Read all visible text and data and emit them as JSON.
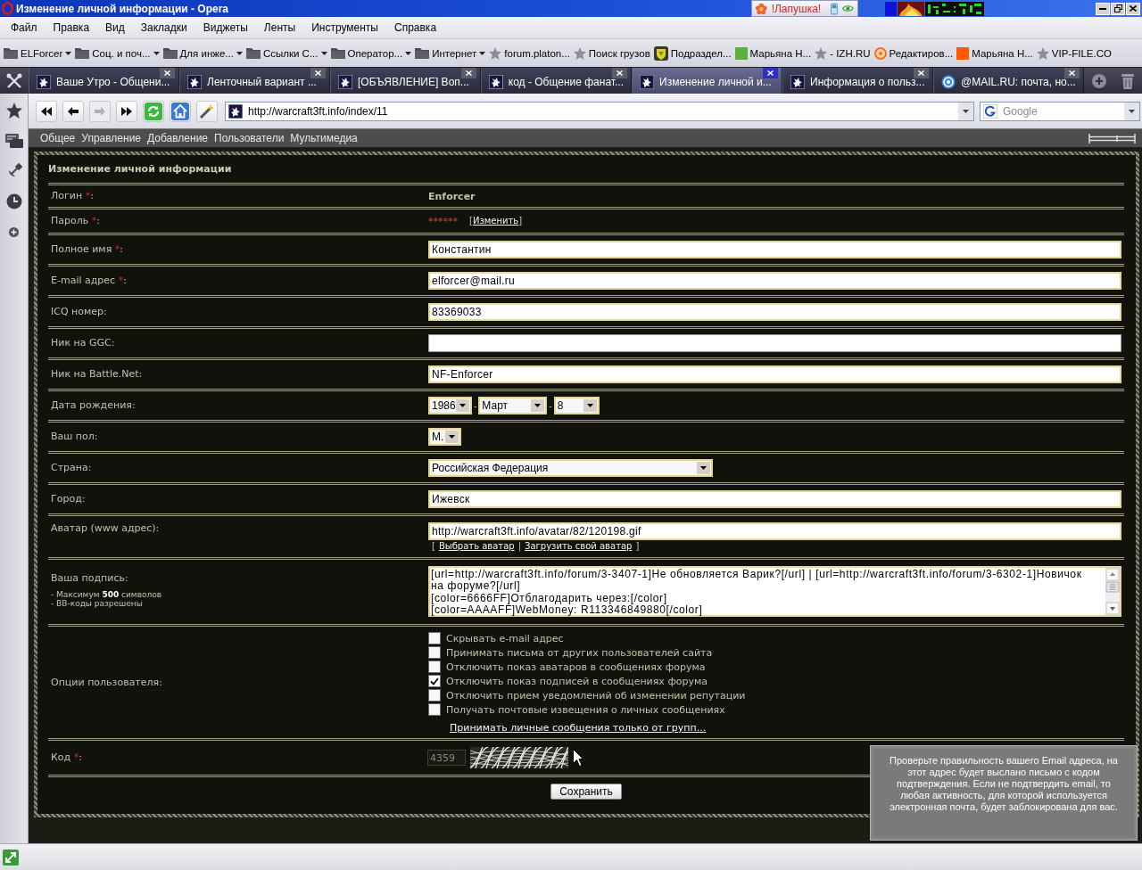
{
  "window": {
    "title": "Изменение личной информации - Opera",
    "widget_label": "!Лапушка!"
  },
  "menu": [
    "Файл",
    "Правка",
    "Вид",
    "Закладки",
    "Виджеты",
    "Ленты",
    "Инструменты",
    "Справка"
  ],
  "bookmarks": [
    {
      "kind": "folder",
      "label": "ELForcer"
    },
    {
      "kind": "folder",
      "label": "Соц. и поч..."
    },
    {
      "kind": "folder",
      "label": "Для инже..."
    },
    {
      "kind": "folder",
      "label": "Ссылки С..."
    },
    {
      "kind": "folder",
      "label": "Оператор..."
    },
    {
      "kind": "folder",
      "label": "Интернет"
    },
    {
      "kind": "star",
      "label": "forum.platon..."
    },
    {
      "kind": "star",
      "label": "Поиск грузов"
    },
    {
      "kind": "badge",
      "label": "Подраздел..."
    },
    {
      "kind": "square",
      "label": "Марьяна Н...",
      "color": "#5cb040"
    },
    {
      "kind": "star",
      "label": "- IZH.RU"
    },
    {
      "kind": "target",
      "label": "Редактиров..."
    },
    {
      "kind": "square",
      "label": "Марьяна Н...",
      "color": "#ff5a00"
    },
    {
      "kind": "star",
      "label": "VIP-FILE.CO"
    }
  ],
  "tabs": [
    {
      "kind": "site",
      "label": "Ваше Утро - Общени...",
      "selected": false
    },
    {
      "kind": "site",
      "label": "Ленточный вариант ...",
      "selected": false
    },
    {
      "kind": "site",
      "label": "[ОБЪЯВЛЕНИЕ] Воп...",
      "selected": false
    },
    {
      "kind": "site",
      "label": "код - Общение фанат...",
      "selected": false
    },
    {
      "kind": "site",
      "label": "Изменение личной и...",
      "selected": true
    },
    {
      "kind": "site",
      "label": "Информация о польз...",
      "selected": false
    },
    {
      "kind": "mail",
      "label": "@MAIL.RU: почта, но...",
      "selected": false
    }
  ],
  "toolbar": {
    "buttons": [
      {
        "kind": "rewind",
        "disabled": false
      },
      {
        "kind": "back",
        "disabled": false
      },
      {
        "kind": "forward",
        "disabled": true
      },
      {
        "kind": "fastforward",
        "disabled": false
      },
      {
        "kind": "reload",
        "disabled": false
      },
      {
        "kind": "home",
        "disabled": false
      },
      {
        "kind": "wand",
        "disabled": false
      }
    ],
    "url": "http://warcraft3ft.info/index/11",
    "search": {
      "placeholder": "Google"
    }
  },
  "site_nav": [
    "Общее",
    "Управление",
    "Добавление",
    "Пользователи",
    "Мультимедиа"
  ],
  "form": {
    "title": "Изменение личной информации",
    "rows": [
      {
        "kind": "static",
        "label": "Логин",
        "required_mark": "*",
        "suffix": ":",
        "value": "Enforcer"
      },
      {
        "kind": "password",
        "label": "Пароль",
        "required_mark": "*",
        "suffix": ":",
        "value": "******",
        "link_open": "[",
        "link": "Изменить",
        "link_close": "]"
      },
      {
        "kind": "input",
        "label": "Полное имя",
        "required_mark": "*",
        "suffix": ":",
        "value": "Константин"
      },
      {
        "kind": "input",
        "label": "E-mail адрес",
        "required_mark": "*",
        "suffix": ":",
        "value": "elforcer@mail.ru"
      },
      {
        "kind": "input",
        "label": "ICQ номер:",
        "value": "83369033"
      },
      {
        "kind": "input",
        "label": "Ник на GGC:"
      },
      {
        "kind": "input",
        "label": "Ник на Battle.Net:",
        "value": "NF-Enforcer"
      },
      {
        "kind": "date",
        "label": "Дата рождения:",
        "selects": [
          "1986",
          "Март",
          "8"
        ],
        "separator": "-"
      },
      {
        "kind": "select",
        "label": "Ваш пол:",
        "value": "М."
      },
      {
        "kind": "wideselect",
        "label": "Страна:",
        "value": "Российская Федерация"
      },
      {
        "kind": "input",
        "label": "Город:",
        "value": "Ижевск"
      },
      {
        "kind": "avatar",
        "label": "Аватар (www адрес):",
        "value": "http://warcraft3ft.info/avatar/82/120198.gif",
        "link_open": "[",
        "links": [
          "Выбрать аватар",
          "Загрузить свой аватар"
        ],
        "link_divider": "|",
        "link_close": "]"
      },
      {
        "kind": "textarea",
        "label": "Ваша подпись:",
        "notes": [
          "- Максимум **500** символов",
          "- BB-коды разрешены"
        ],
        "lines": [
          "[url=http://warcraft3ft.info/forum/3-3407-1]Не обновляется Варик?[/url] | [url=http://warcraft3ft.info/forum/3-6302-1]Новичок",
          "на форуме?[/url]",
          "[color=6666FF]Отблагодарить через:[/color]",
          "[color=AAAAFF]WebMoney: R113346849880[/color]"
        ]
      },
      {
        "kind": "options",
        "label": "Опции пользователя:",
        "options": [
          {
            "label": "Скрывать e-mail адрес",
            "checked": false
          },
          {
            "label": "Принимать письма от других пользователей сайта",
            "checked": false
          },
          {
            "label": "Отключить показ аватаров в сообщениях форума",
            "checked": false
          },
          {
            "label": "Отключить показ подписей в сообщениях форума",
            "checked": true
          },
          {
            "label": "Отключить прием уведомлений об изменении репутации",
            "checked": false
          },
          {
            "label": "Получать почтовые извещения о личных сообщениях",
            "checked": false
          }
        ],
        "link": "Принимать личные сообщения только от групп..."
      },
      {
        "kind": "captcha",
        "label": "Код",
        "required_mark": "*",
        "suffix": ":",
        "value": "4359"
      }
    ],
    "save": "Сохранить"
  },
  "tooltip": {
    "text": "Проверьте правильность вашего Email адреса, на этот адрес будет выслано письмо с кодом подтверждения. Если не подтвердить email, то любая активность, для которой используется электронная почта, будет заблокирована для вас."
  }
}
